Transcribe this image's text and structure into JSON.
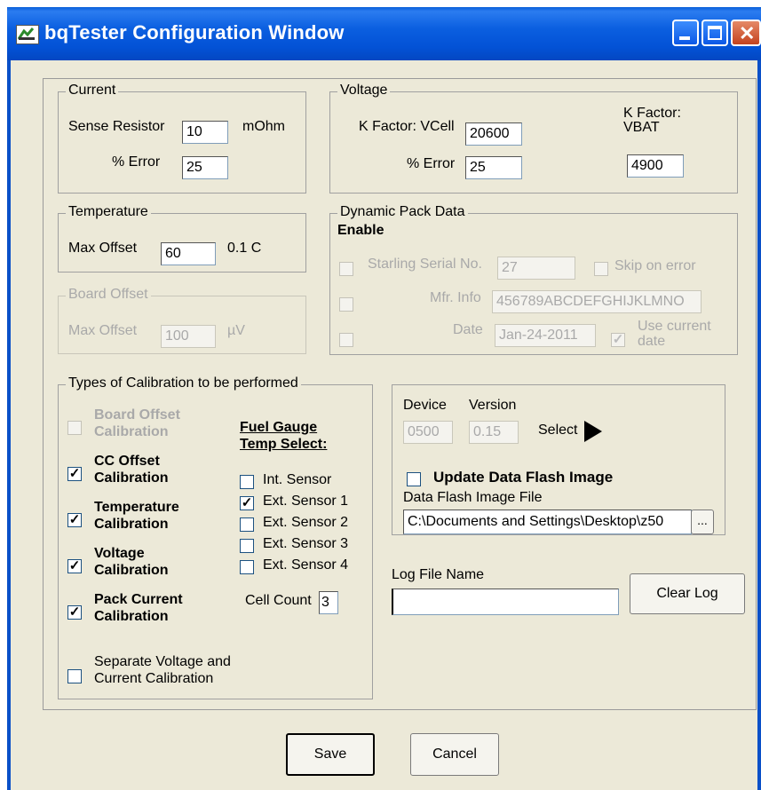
{
  "window": {
    "title": "bqTester Configuration Window",
    "buttons": {
      "minimize": "_",
      "maximize": "□",
      "close": "✕"
    }
  },
  "current": {
    "legend": "Current",
    "sense_resistor_label": "Sense Resistor",
    "sense_resistor_value": "10",
    "sense_resistor_unit": "mOhm",
    "error_label": "% Error",
    "error_value": "25"
  },
  "voltage": {
    "legend": "Voltage",
    "kfactor_vcell_label": "K Factor: VCell",
    "kfactor_vcell_value": "20600",
    "kfactor_vbat_label_1": "K Factor:",
    "kfactor_vbat_label_2": "VBAT",
    "kfactor_vbat_value": "4900",
    "error_label": "% Error",
    "error_value": "25"
  },
  "temperature": {
    "legend": "Temperature",
    "max_offset_label": "Max Offset",
    "max_offset_value": "60",
    "unit": "0.1 C"
  },
  "board_offset": {
    "legend": "Board Offset",
    "max_offset_label": "Max Offset",
    "max_offset_value": "100",
    "unit": "µV"
  },
  "dynamic_pack": {
    "legend": "Dynamic Pack Data",
    "enable_label": "Enable",
    "serial_label": "Starling Serial No.",
    "serial_value": "27",
    "skip_label": "Skip on error",
    "mfr_label": "Mfr. Info",
    "mfr_value": "456789ABCDEFGHIJKLMNO",
    "date_label": "Date",
    "date_value": "Jan-24-2011",
    "use_current_1": "Use current",
    "use_current_2": "date"
  },
  "calibration": {
    "legend": "Types of Calibration to be performed",
    "board_offset_1": "Board Offset",
    "board_offset_2": "Calibration",
    "cc_offset_1": "CC Offset",
    "cc_offset_2": "Calibration",
    "temperature_1": "Temperature",
    "temperature_2": "Calibration",
    "voltage_1": "Voltage",
    "voltage_2": "Calibration",
    "pack_current_1": "Pack Current",
    "pack_current_2": "Calibration",
    "fuel_gauge_1": "Fuel Gauge",
    "fuel_gauge_2": "Temp Select:",
    "sensors": [
      "Int. Sensor",
      "Ext. Sensor 1",
      "Ext. Sensor 2",
      "Ext. Sensor 3",
      "Ext. Sensor 4"
    ],
    "cell_count_label": "Cell Count",
    "cell_count_value": "3",
    "separate_1": "Separate Voltage and",
    "separate_2": "Current Calibration",
    "check": "✓"
  },
  "device": {
    "device_label": "Device",
    "version_label": "Version",
    "device_value": "0500",
    "version_value": "0.15",
    "select_label": "Select",
    "update_label": "Update Data Flash Image",
    "file_label": "Data Flash Image File",
    "file_value": "C:\\Documents and Settings\\Desktop\\z50",
    "browse_label": "..."
  },
  "log": {
    "label": "Log File Name",
    "value": "",
    "clear_label": "Clear Log"
  },
  "footer": {
    "save_label": "Save",
    "cancel_label": "Cancel"
  }
}
